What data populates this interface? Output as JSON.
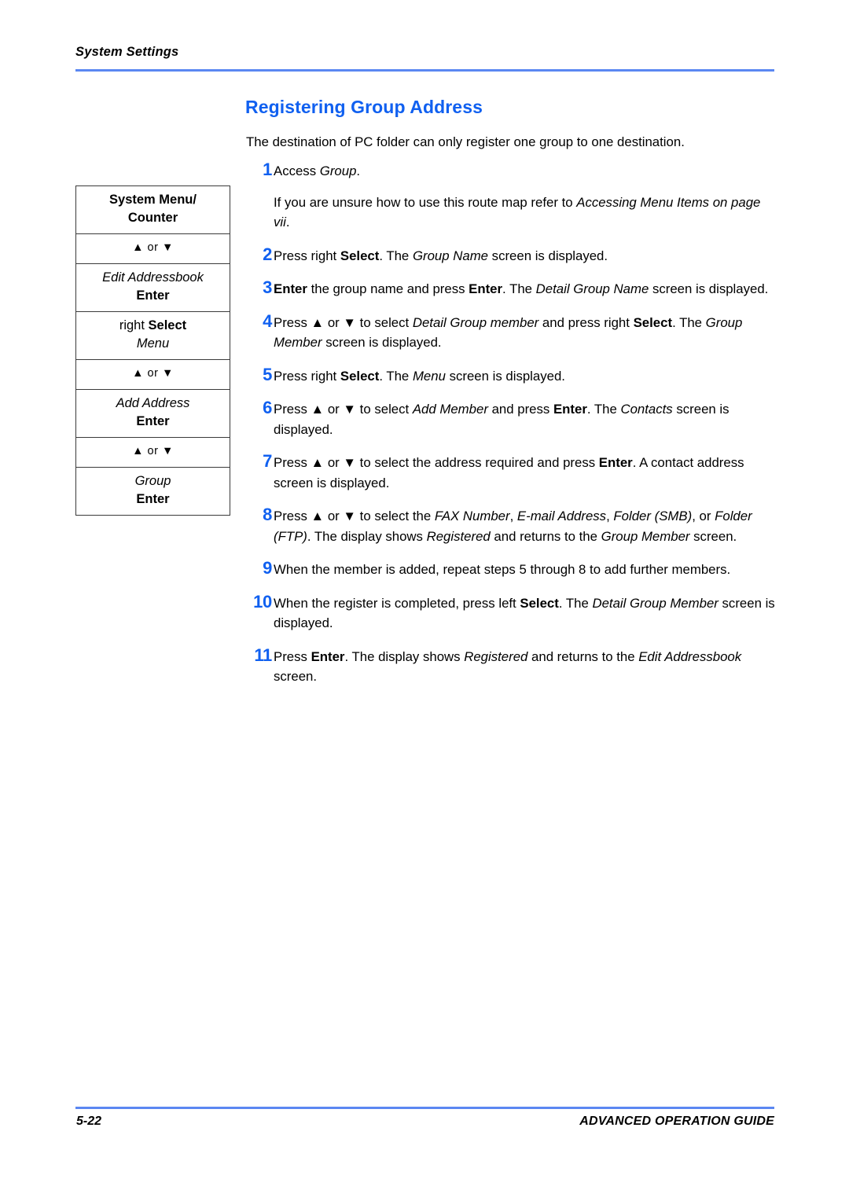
{
  "page": {
    "running_header": "System Settings",
    "heading": "Registering Group Address",
    "intro": "The destination of PC folder can only register one group to one destination.",
    "accent_blue": "#1060f0",
    "rule_blue": "#5b87f2"
  },
  "route_map": {
    "rows": [
      {
        "lines": [
          {
            "text": "System Menu/",
            "style": "bold"
          },
          {
            "text": "Counter",
            "style": "bold"
          }
        ]
      },
      {
        "lines": [
          {
            "text": "▲ or ▼",
            "style": "arrow"
          }
        ]
      },
      {
        "lines": [
          {
            "text": "Edit Addressbook",
            "style": "italic"
          },
          {
            "text": "Enter",
            "style": "bold"
          }
        ]
      },
      {
        "lines": [
          {
            "text": "right Select",
            "style": "mixed",
            "regular": "right ",
            "bold": "Select"
          },
          {
            "text": "Menu",
            "style": "italic"
          }
        ]
      },
      {
        "lines": [
          {
            "text": "▲ or ▼",
            "style": "arrow"
          }
        ]
      },
      {
        "lines": [
          {
            "text": "Add Address",
            "style": "italic"
          },
          {
            "text": "Enter",
            "style": "bold"
          }
        ]
      },
      {
        "lines": [
          {
            "text": "▲ or ▼",
            "style": "arrow"
          }
        ]
      },
      {
        "lines": [
          {
            "text": "Group",
            "style": "italic"
          },
          {
            "text": "Enter",
            "style": "bold"
          }
        ]
      }
    ]
  },
  "steps": [
    {
      "num": "1",
      "body_plain": "Access Group.",
      "sub_plain": "If you are unsure how to use this route map refer to Accessing Menu Items on page vii."
    },
    {
      "num": "2",
      "body_plain": "Press right Select. The Group Name screen is displayed."
    },
    {
      "num": "3",
      "body_plain": "Enter the group name and press Enter. The Detail Group Name screen is displayed."
    },
    {
      "num": "4",
      "body_plain": "Press ▲ or ▼ to select Detail Group member and press right Select. The Group Member screen is displayed."
    },
    {
      "num": "5",
      "body_plain": "Press right Select. The Menu screen is displayed."
    },
    {
      "num": "6",
      "body_plain": "Press ▲ or ▼ to select Add Member and press Enter. The Contacts screen is displayed."
    },
    {
      "num": "7",
      "body_plain": "Press ▲ or ▼ to select the address required and press Enter. A contact address screen is displayed."
    },
    {
      "num": "8",
      "body_plain": "Press ▲ or ▼ to select the FAX Number, E-mail Address, Folder (SMB), or Folder (FTP). The display shows Registered and returns to the Group Member screen."
    },
    {
      "num": "9",
      "body_plain": "When the member is added, repeat steps 5 through 8 to add further members."
    },
    {
      "num": "10",
      "body_plain": "When the register is completed, press left Select. The Detail Group Member screen is displayed."
    },
    {
      "num": "11",
      "body_plain": "Press Enter. The display shows Registered and returns to the Edit Addressbook screen."
    }
  ],
  "footer": {
    "page_number": "5-22",
    "guide_title": "ADVANCED OPERATION GUIDE"
  }
}
